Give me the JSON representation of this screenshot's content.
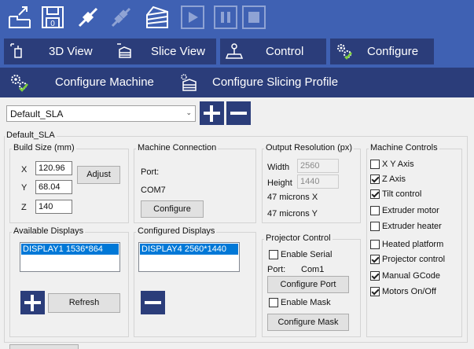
{
  "toolbar": {
    "buttons": [
      {
        "name": "export-icon"
      },
      {
        "name": "save-icon",
        "text": "0"
      },
      {
        "name": "connect-icon"
      },
      {
        "name": "disconnect-icon"
      },
      {
        "name": "slice-icon"
      },
      {
        "name": "play-icon"
      },
      {
        "name": "pause-icon"
      },
      {
        "name": "stop-icon"
      }
    ]
  },
  "tabs": [
    {
      "label": "3D View",
      "icon": "cube-hand-icon"
    },
    {
      "label": "Slice View",
      "icon": "slice-hand-icon"
    },
    {
      "label": "Control",
      "icon": "joystick-icon"
    },
    {
      "label": "Configure",
      "icon": "gears-icon"
    }
  ],
  "subtabs": [
    {
      "label": "Configure Machine",
      "icon": "gears-check-icon"
    },
    {
      "label": "Configure Slicing Profile",
      "icon": "slice-profile-icon"
    }
  ],
  "profile": {
    "selected": "Default_SLA"
  },
  "machine": {
    "title": "Default_SLA",
    "build_size": {
      "title": "Build Size (mm)",
      "x_label": "X",
      "x": "120.96",
      "y_label": "Y",
      "y": "68.04",
      "z_label": "Z",
      "z": "140",
      "adjust": "Adjust"
    },
    "connection": {
      "title": "Machine Connection",
      "port_label": "Port:",
      "port": "COM7",
      "configure": "Configure"
    },
    "output": {
      "title": "Output Resolution (px)",
      "width_label": "Width",
      "width": "2560",
      "height_label": "Height",
      "height": "1440",
      "microns_x": "47 microns X",
      "microns_y": "47 microns Y"
    },
    "controls": {
      "title": "Machine Controls",
      "items": [
        {
          "label": "X Y Axis",
          "checked": false
        },
        {
          "label": "Z Axis",
          "checked": true
        },
        {
          "label": "Tilt control",
          "checked": true
        },
        {
          "label": "Extruder motor",
          "checked": false
        },
        {
          "label": "Extruder heater",
          "checked": false
        },
        {
          "label": "Heated platform",
          "checked": false
        },
        {
          "label": "Projector control",
          "checked": true
        },
        {
          "label": "Manual GCode",
          "checked": true
        },
        {
          "label": "Motors On/Off",
          "checked": true
        }
      ]
    },
    "available": {
      "title": "Available Displays",
      "items": [
        "DISPLAY1 1536*864"
      ],
      "refresh": "Refresh"
    },
    "configured": {
      "title": "Configured Displays",
      "items": [
        "DISPLAY4 2560*1440"
      ]
    },
    "projector": {
      "title": "Projector Control",
      "enable_serial": "Enable Serial",
      "port_label": "Port:",
      "port": "Com1",
      "configure_port": "Configure Port",
      "enable_mask": "Enable Mask",
      "configure_mask": "Configure Mask"
    }
  }
}
